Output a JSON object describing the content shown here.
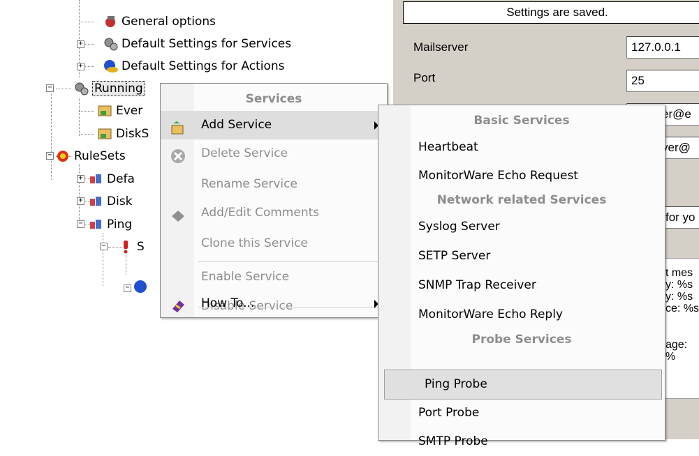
{
  "tree": {
    "nodes": [
      {
        "label": "General options",
        "icon": "general-options-icon"
      },
      {
        "label": "Default Settings for Services",
        "icon": "service-gears-icon"
      },
      {
        "label": "Default Settings for Actions",
        "icon": "actions-globe-icon"
      },
      {
        "label": "Running ",
        "icon": "service-gears-icon"
      },
      {
        "label": "Ever",
        "icon": "service-item-icon"
      },
      {
        "label": "DiskS",
        "icon": "service-item-icon"
      },
      {
        "label": "RuleSets",
        "icon": "rulesets-icon"
      },
      {
        "label": "Defa",
        "icon": "ruleset-icon"
      },
      {
        "label": "Disk",
        "icon": "ruleset-icon"
      },
      {
        "label": "Ping",
        "icon": "ruleset-icon"
      },
      {
        "label": "S",
        "icon": "rule-icon"
      }
    ]
  },
  "right_panel": {
    "status": "Settings are saved.",
    "mailserver_label": "Mailserver",
    "mailserver_value": "127.0.0.1",
    "port_label": "Port",
    "port_value": "25",
    "fragments": [
      "er@e",
      "ver@",
      "for yo",
      "t mes",
      "y: %s",
      "y: %s",
      "ce: %s",
      "age:",
      "%"
    ]
  },
  "context_menu": {
    "header": "Services",
    "items": [
      {
        "label": "Add Service",
        "enabled": true,
        "submenu": true,
        "icon": "add-service-icon"
      },
      {
        "label": "Delete Service",
        "enabled": false,
        "icon": "delete-icon"
      },
      {
        "label": "Rename Service",
        "enabled": false
      },
      {
        "label": "Add/Edit Comments",
        "enabled": false,
        "icon": "comment-icon"
      },
      {
        "label": "Clone this Service",
        "enabled": false
      },
      {
        "label": "Enable Service",
        "enabled": false
      },
      {
        "label": "Disable Service",
        "enabled": false
      },
      {
        "label": "How To...",
        "enabled": true,
        "submenu": true,
        "icon": "book-icon"
      }
    ]
  },
  "submenu": {
    "sections": [
      {
        "header": "Basic Services",
        "items": [
          "Heartbeat",
          "MonitorWare Echo Request"
        ]
      },
      {
        "header": "Network related Services",
        "items": [
          "Syslog Server",
          "SETP Server",
          "SNMP Trap Receiver",
          "MonitorWare Echo Reply"
        ]
      },
      {
        "header": "Probe Services",
        "items": [
          "Ping Probe",
          "Port Probe",
          "SMTP Probe"
        ]
      }
    ],
    "highlighted": "Ping Probe"
  }
}
